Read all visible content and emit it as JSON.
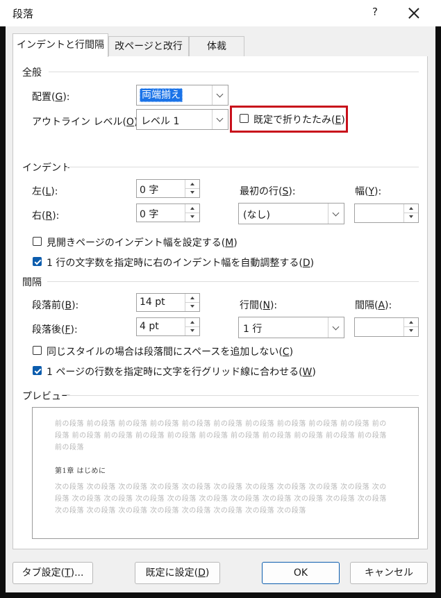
{
  "window": {
    "title": "段落",
    "help_label": "?"
  },
  "tabs": [
    {
      "label": "インデントと行間隔",
      "active": true
    },
    {
      "label": "改ページと改行",
      "active": false
    },
    {
      "label": "体裁",
      "active": false
    }
  ],
  "general": {
    "heading": "全般",
    "alignment": {
      "label": "配置(",
      "key": "G",
      "suffix": "):",
      "value": "両端揃え"
    },
    "outline": {
      "label": "アウトライン レベル(",
      "key": "O",
      "suffix": "):",
      "value": "レベル 1"
    },
    "collapse": {
      "label": "既定で折りたたみ(",
      "key": "E",
      "suffix": ")",
      "checked": false
    }
  },
  "indent": {
    "heading": "インデント",
    "left": {
      "label": "左(",
      "key": "L",
      "suffix": "):",
      "value": "0 字"
    },
    "right": {
      "label": "右(",
      "key": "R",
      "suffix": "):",
      "value": "0 字"
    },
    "first_line": {
      "label": "最初の行(",
      "key": "S",
      "suffix": "):",
      "value": "(なし)"
    },
    "width": {
      "label": "幅(",
      "key": "Y",
      "suffix": "):",
      "value": ""
    },
    "mirror": {
      "label": "見開きページのインデント幅を設定する(",
      "key": "M",
      "suffix": ")",
      "checked": false
    },
    "auto_adjust": {
      "label": "1 行の文字数を指定時に右のインデント幅を自動調整する(",
      "key": "D",
      "suffix": ")",
      "checked": true
    }
  },
  "spacing": {
    "heading": "間隔",
    "before": {
      "label": "段落前(",
      "key": "B",
      "suffix": "):",
      "value": "14 pt"
    },
    "after": {
      "label": "段落後(",
      "key": "F",
      "suffix": "):",
      "value": "4 pt"
    },
    "line_spacing": {
      "label": "行間(",
      "key": "N",
      "suffix": "):",
      "value": "1 行"
    },
    "at": {
      "label": "間隔(",
      "key": "A",
      "suffix": "):",
      "value": ""
    },
    "no_space_same_style": {
      "label": "同じスタイルの場合は段落間にスペースを追加しない(",
      "key": "C",
      "suffix": ")",
      "checked": false
    },
    "snap_to_grid": {
      "label": "1 ページの行数を指定時に文字を行グリッド線に合わせる(",
      "key": "W",
      "suffix": ")",
      "checked": true
    }
  },
  "preview": {
    "heading": "プレビュー",
    "prev_lines": [
      "前の段落 前の段落 前の段落 前の段落 前の段落 前の段落 前の段落 前の段落 前の段落 前の段落 前の",
      "段落 前の段落 前の段落 前の段落 前の段落 前の段落 前の段落 前の段落 前の段落 前の段落 前の段落",
      "前の段落"
    ],
    "current_line": "第1章 はじめに",
    "next_lines": [
      "次の段落 次の段落 次の段落 次の段落 次の段落 次の段落 次の段落 次の段落 次の段落 次の段落 次の",
      "段落 次の段落 次の段落 次の段落 次の段落 次の段落 次の段落 次の段落 次の段落 次の段落 次の段落",
      "次の段落 次の段落 次の段落 次の段落 次の段落 次の段落 次の段落 次の段落"
    ]
  },
  "buttons": {
    "tabs": {
      "label": "タブ設定(",
      "key": "T",
      "suffix": ")..."
    },
    "set_default": {
      "label": "既定に設定(",
      "key": "D",
      "suffix": ")"
    },
    "ok": {
      "label": "OK"
    },
    "cancel": {
      "label": "キャンセル"
    }
  },
  "colors": {
    "accent": "#0b5cad",
    "highlight_border": "#c8101b",
    "selection": "#1a73e8"
  }
}
